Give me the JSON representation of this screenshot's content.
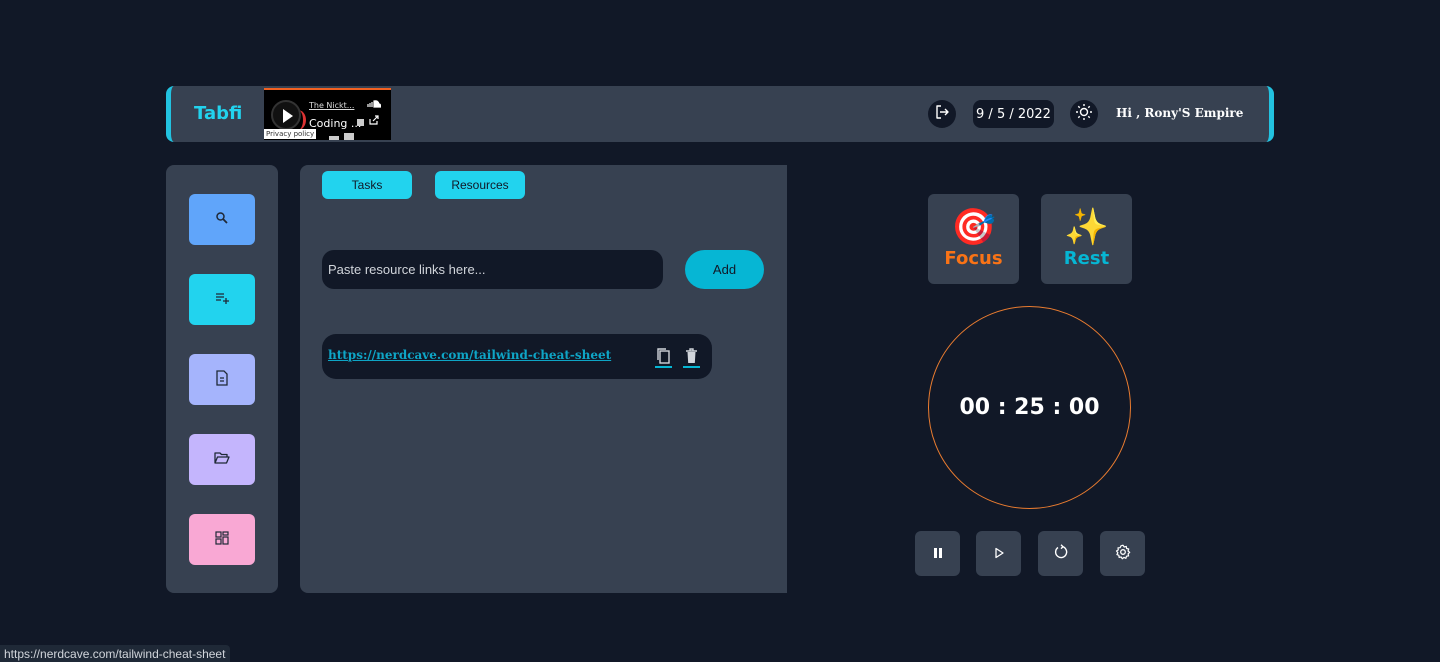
{
  "header": {
    "brand": "Tabfi",
    "player": {
      "artist": "The Nickt...",
      "track": "Coding ...",
      "privacy": "Privacy policy"
    },
    "date": "9 / 5 / 2022",
    "greeting": "Hi , Rony'S Empire",
    "icons": [
      "logout-icon",
      "sun-icon"
    ]
  },
  "sidebar": {
    "items": [
      {
        "name": "search",
        "icon": "search-icon",
        "color": "#60a5fa"
      },
      {
        "name": "add-task",
        "icon": "playlist-add-icon",
        "color": "#22d3ee"
      },
      {
        "name": "notes",
        "icon": "document-icon",
        "color": "#a5b4fc"
      },
      {
        "name": "resources",
        "icon": "folder-open-icon",
        "color": "#c4b5fd"
      },
      {
        "name": "dashboard",
        "icon": "grid-icon",
        "color": "#f9a8d4"
      }
    ]
  },
  "main": {
    "tabs": [
      {
        "label": "Tasks"
      },
      {
        "label": "Resources"
      }
    ],
    "resource_input": {
      "placeholder": "Paste resource links here...",
      "value": ""
    },
    "add_label": "Add",
    "resources": [
      {
        "url": "https://nerdcave.com/tailwind-cheat-sheet"
      }
    ]
  },
  "timer": {
    "modes": [
      {
        "label": "Focus",
        "emoji": "🎯",
        "color": "#f97316"
      },
      {
        "label": "Rest",
        "emoji": "✨",
        "color": "#06b6d4"
      }
    ],
    "display": "00 : 25 : 00",
    "controls": [
      "pause-icon",
      "play-icon",
      "reset-icon",
      "settings-icon"
    ]
  },
  "status_bar": {
    "url": "https://nerdcave.com/tailwind-cheat-sheet"
  }
}
